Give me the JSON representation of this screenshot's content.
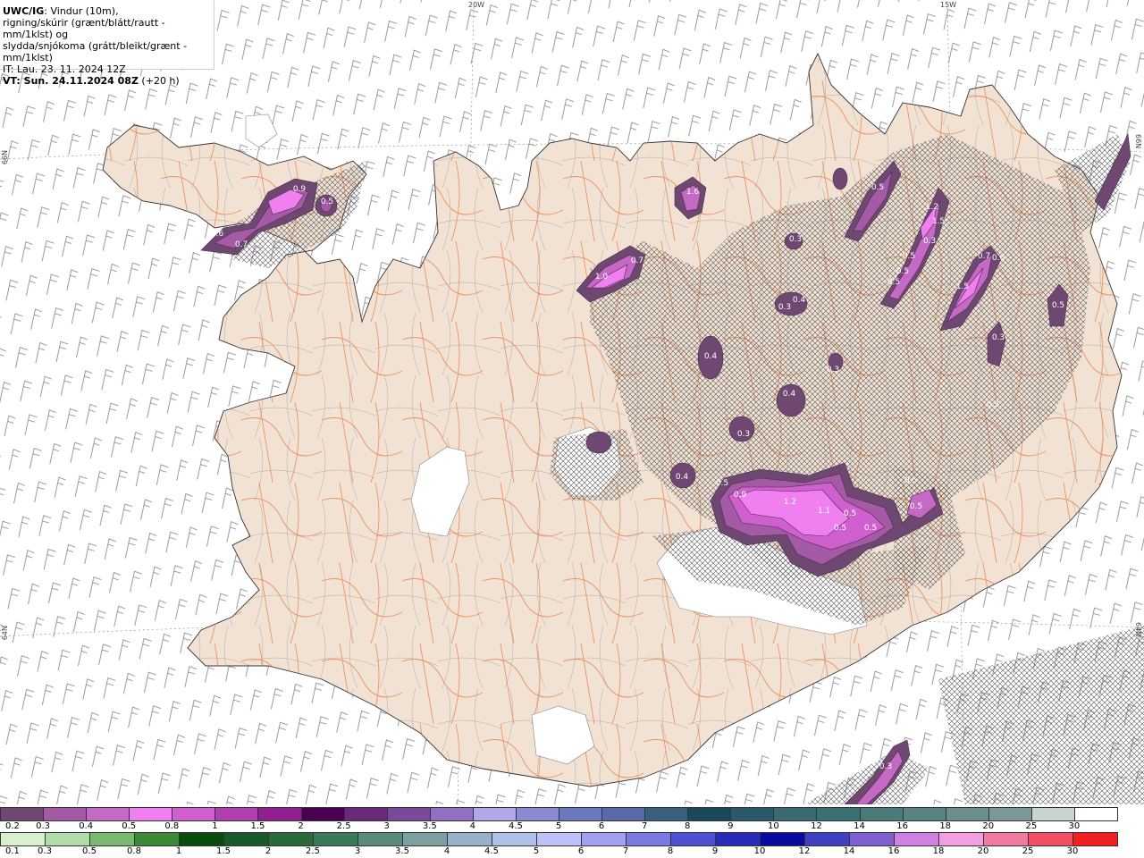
{
  "header": {
    "model": "UWC/IG",
    "title_rest": ": Vindur (10m),",
    "line2": "rigning/skúrir (grænt/blátt/rautt - mm/1klst) og",
    "line3": "slydda/snjókoma (grátt/bleikt/grænt - mm/1klst)",
    "it": "IT: Lau. 23. 11. 2024 12Z",
    "vt_prefix": "VT: Sun. 24.11.2024 08Z",
    "vt_suffix": " (+20 h)"
  },
  "axes": {
    "lon_20w": "20W",
    "lon_15w": "15W",
    "lat_left_top": "66N",
    "lat_left_bottom": "64N",
    "lat_right_top": "66N",
    "lat_right_bottom": "64N"
  },
  "precip_labels": [
    {
      "text": "0.9"
    },
    {
      "text": "0.5"
    },
    {
      "text": "0.6"
    },
    {
      "text": "0.7"
    },
    {
      "text": "1.6"
    },
    {
      "text": "0.7"
    },
    {
      "text": "1.0"
    },
    {
      "text": "0.5"
    },
    {
      "text": "1.2"
    },
    {
      "text": "1.5"
    },
    {
      "text": "0.3"
    },
    {
      "text": "0.4"
    },
    {
      "text": "0.3"
    },
    {
      "text": "0.5"
    },
    {
      "text": "0.5"
    },
    {
      "text": "0.5"
    },
    {
      "text": "0.3"
    },
    {
      "text": "0.4"
    },
    {
      "text": "0.4"
    },
    {
      "text": "0.3"
    },
    {
      "text": "0.3"
    },
    {
      "text": "0.4"
    },
    {
      "text": "0.5"
    },
    {
      "text": "0.9"
    },
    {
      "text": "1.2"
    },
    {
      "text": "1.1"
    },
    {
      "text": "0.5"
    },
    {
      "text": "0.5"
    },
    {
      "text": "0.5"
    },
    {
      "text": "0.5"
    },
    {
      "text": "0.5"
    },
    {
      "text": "0.7"
    },
    {
      "text": "1.5"
    },
    {
      "text": "0.6"
    },
    {
      "text": "0.3"
    },
    {
      "text": "0.3"
    },
    {
      "text": "0.5"
    },
    {
      "text": "0.3"
    }
  ],
  "scale_top": {
    "labels": [
      "0.2",
      "0.3",
      "0.4",
      "0.5",
      "0.8",
      "1",
      "1.5",
      "2",
      "2.5",
      "3",
      "3.5",
      "4",
      "4.5",
      "5",
      "6",
      "7",
      "8",
      "9",
      "10",
      "12",
      "14",
      "16",
      "18",
      "20",
      "25",
      "30"
    ],
    "colors": [
      "#6e4870",
      "#a45aa4",
      "#c46ac4",
      "#f080f0",
      "#d060d0",
      "#b040b0",
      "#902090",
      "#4a0050",
      "#6a2a7a",
      "#7a4a9a",
      "#9070c0",
      "#b0a8e8",
      "#8a8ad0",
      "#6a78c0",
      "#5a6aa8",
      "#3a6080",
      "#1a4a5a",
      "#2a5a6a",
      "#3a6a72",
      "#3a7070",
      "#4a7a7a",
      "#5a8484",
      "#6a8e8e",
      "#7a9898",
      "#c8d4d4",
      "#ffffff"
    ]
  },
  "scale_bottom": {
    "labels": [
      "0.1",
      "0.3",
      "0.5",
      "0.8",
      "1",
      "1.5",
      "2",
      "2.5",
      "3",
      "3.5",
      "4",
      "4.5",
      "5",
      "6",
      "7",
      "8",
      "9",
      "10",
      "12",
      "14",
      "16",
      "18",
      "20",
      "25",
      "30"
    ],
    "colors": [
      "#d8f0d0",
      "#b0dca8",
      "#78b870",
      "#3a8a3a",
      "#0a4a0a",
      "#1a5a2a",
      "#2a6a3a",
      "#3a7a5a",
      "#5a8a7a",
      "#7aa0a0",
      "#9ab0c8",
      "#b0c0e8",
      "#c0c0f8",
      "#a0a0f0",
      "#7a7ae0",
      "#5050d0",
      "#2a2ab8",
      "#0a0aa0",
      "#4040c0",
      "#8060d0",
      "#d080e0",
      "#f0a0e0",
      "#f07aa0",
      "#f05060",
      "#f02020"
    ]
  }
}
